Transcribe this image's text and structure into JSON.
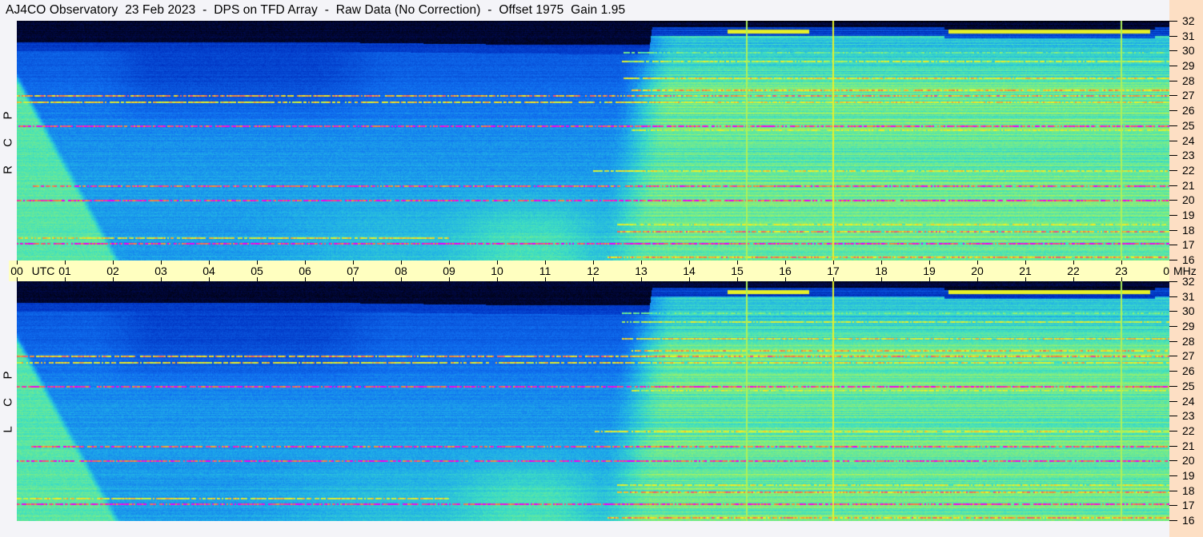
{
  "title": "AJ4CO Observatory  23 Feb 2023  -  DPS on TFD Array  -  Raw Data (No Correction)  -  Offset 1975  Gain 1.95",
  "panels": [
    {
      "id": "rcp",
      "label_letters": [
        "P",
        "C",
        "R"
      ],
      "label": "RCP"
    },
    {
      "id": "lcp",
      "label_letters": [
        "P",
        "C",
        "L"
      ],
      "label": "LCP"
    }
  ],
  "time_axis": {
    "labels": [
      "00",
      "01",
      "02",
      "03",
      "04",
      "05",
      "06",
      "07",
      "08",
      "09",
      "10",
      "11",
      "12",
      "13",
      "14",
      "15",
      "16",
      "17",
      "18",
      "19",
      "20",
      "21",
      "22",
      "23",
      "00"
    ],
    "unit_label": "UTC"
  },
  "freq_axis": {
    "labels": [
      "32",
      "31",
      "30",
      "29",
      "28",
      "27",
      "26",
      "25",
      "24",
      "23",
      "22",
      "21",
      "20",
      "19",
      "18",
      "17",
      "16"
    ],
    "unit_label": "MHz"
  },
  "chart_data": {
    "type": "heatmap",
    "title": "AJ4CO Observatory 23 Feb 2023 - DPS on TFD Array - Raw Data (No Correction) - Offset 1975 Gain 1.95",
    "xlabel": "UTC",
    "ylabel": "MHz",
    "xlim": [
      0,
      24
    ],
    "ylim": [
      16,
      32
    ],
    "series": [
      "RCP",
      "LCP"
    ],
    "vertical_lines_utc": [
      15.18,
      16.98,
      22.98
    ],
    "bright_band": {
      "freq_mhz": 31.3,
      "intervals_utc": [
        [
          14.8,
          16.5
        ],
        [
          19.4,
          23.6
        ]
      ]
    },
    "interference_lines": [
      {
        "freq_mhz": 16.2,
        "level": 0.9,
        "utc": [
          12.3,
          24
        ]
      },
      {
        "freq_mhz": 17.1,
        "level": 0.97,
        "utc": [
          0,
          24
        ]
      },
      {
        "freq_mhz": 17.5,
        "level": 0.85,
        "utc": [
          0,
          9
        ]
      },
      {
        "freq_mhz": 17.9,
        "level": 0.9,
        "utc": [
          12.5,
          24
        ]
      },
      {
        "freq_mhz": 18.4,
        "level": 0.82,
        "utc": [
          12.5,
          24
        ]
      },
      {
        "freq_mhz": 20.0,
        "level": 0.97,
        "utc": [
          0,
          24
        ]
      },
      {
        "freq_mhz": 21.0,
        "level": 0.95,
        "utc": [
          0.3,
          24
        ]
      },
      {
        "freq_mhz": 22.0,
        "level": 0.83,
        "utc": [
          12.0,
          24
        ]
      },
      {
        "freq_mhz": 24.7,
        "level": 0.8,
        "utc": [
          12.8,
          24
        ]
      },
      {
        "freq_mhz": 25.0,
        "level": 0.97,
        "utc": [
          0,
          24
        ]
      },
      {
        "freq_mhz": 26.6,
        "level": 0.85,
        "utc": [
          0,
          24
        ]
      },
      {
        "freq_mhz": 27.0,
        "level": 0.9,
        "utc": [
          0,
          24
        ]
      },
      {
        "freq_mhz": 27.4,
        "level": 0.88,
        "utc": [
          12.8,
          24
        ]
      },
      {
        "freq_mhz": 28.2,
        "level": 0.85,
        "utc": [
          12.6,
          24
        ]
      },
      {
        "freq_mhz": 29.3,
        "level": 0.8,
        "utc": [
          12.6,
          24
        ]
      },
      {
        "freq_mhz": 29.9,
        "level": 0.7,
        "utc": [
          12.6,
          24
        ]
      }
    ],
    "colors": [
      "#000000",
      "#000a50",
      "#0030c0",
      "#1070f0",
      "#20b0e8",
      "#40e0c0",
      "#90f070",
      "#f0f020",
      "#f08040",
      "#f000f0"
    ]
  }
}
